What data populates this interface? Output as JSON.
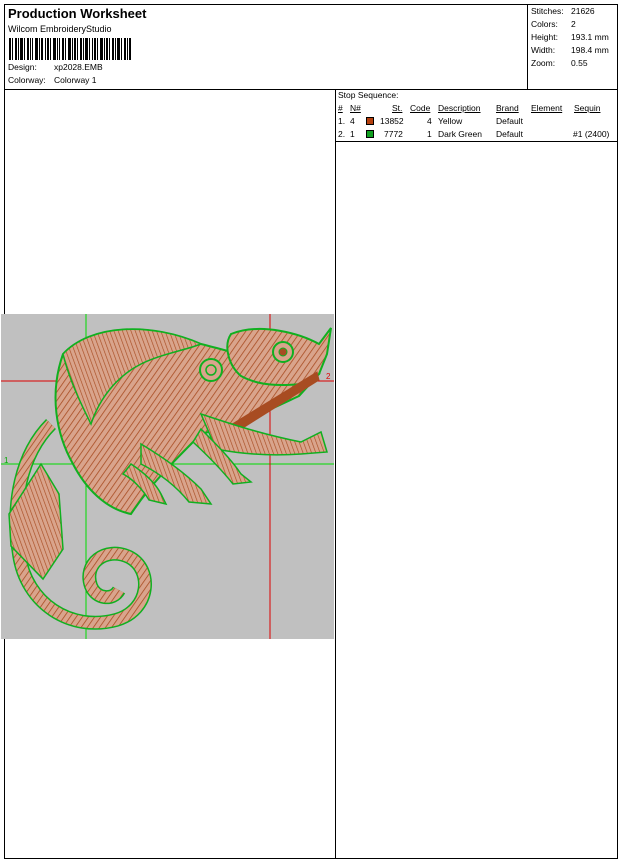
{
  "header": {
    "title": "Production Worksheet",
    "software": "Wilcom EmbroideryStudio",
    "design_label": "Design:",
    "design_value": "xp2028.EMB",
    "colorway_label": "Colorway:",
    "colorway_value": "Colorway 1"
  },
  "stats": [
    {
      "label": "Stitches:",
      "value": "21626"
    },
    {
      "label": "Colors:",
      "value": "2"
    },
    {
      "label": "Height:",
      "value": "193.1 mm"
    },
    {
      "label": "Width:",
      "value": "198.4 mm"
    },
    {
      "label": "Zoom:",
      "value": "0.55"
    }
  ],
  "stop_sequence": {
    "title": "Stop Sequence:",
    "columns": [
      "#",
      "N#",
      "St.",
      "Code",
      "Description",
      "Brand",
      "Element",
      "Sequin"
    ],
    "rows": [
      {
        "num": "1.",
        "n": "4",
        "color": "#b5400e",
        "stitches": "13852",
        "code": "4",
        "description": "Yellow",
        "brand": "Default",
        "element": "",
        "sequin": ""
      },
      {
        "num": "2.",
        "n": "1",
        "color": "#10a020",
        "stitches": "7772",
        "code": "1",
        "description": "Dark Green",
        "brand": "Default",
        "element": "",
        "sequin": "#1 (2400)"
      }
    ]
  },
  "design": {
    "colors": {
      "fill": "#c0c0c0",
      "stitch_brown": "#a84c22",
      "stitch_green": "#10b020",
      "guide_green": "#00dd00",
      "guide_red": "#dd0000"
    },
    "marker_1": "1",
    "marker_2": "2",
    "subject": "chameleon-embroidery"
  }
}
